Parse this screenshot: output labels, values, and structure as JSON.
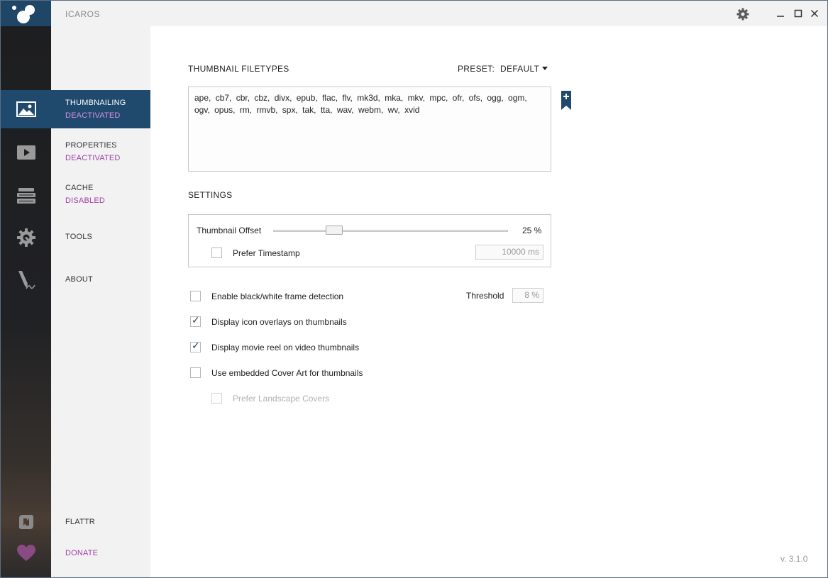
{
  "app": {
    "title": "ICAROS"
  },
  "nav": {
    "thumbnailing": {
      "label": "THUMBNAILING",
      "status": "DEACTIVATED"
    },
    "properties": {
      "label": "PROPERTIES",
      "status": "DEACTIVATED"
    },
    "cache": {
      "label": "CACHE",
      "status": "DISABLED"
    },
    "tools": {
      "label": "TOOLS"
    },
    "about": {
      "label": "ABOUT"
    },
    "flattr": {
      "label": "FLATTR"
    },
    "donate": {
      "label": "DONATE"
    }
  },
  "icons": {
    "rail": [
      "image-icon",
      "play-icon",
      "stack-icon",
      "gear-wrench-icon",
      "pen-icon",
      "flattr-icon",
      "heart-icon"
    ],
    "titlebar": [
      "gear-icon",
      "minimize-icon",
      "maximize-icon",
      "close-icon"
    ]
  },
  "colors": {
    "accent": "#1f4a6e",
    "status": "#a040a8",
    "heart": "#8a4a82"
  },
  "thumbnail_filetypes": {
    "title": "THUMBNAIL FILETYPES",
    "preset_label": "PRESET:",
    "preset_value": "DEFAULT",
    "list": "ape, cb7, cbr, cbz, divx, epub, flac, flv, mk3d, mka, mkv, mpc, ofr, ofs, ogg, ogm, ogv, opus, rm, rmvb, spx, tak, tta, wav, webm, wv, xvid"
  },
  "settings": {
    "title": "SETTINGS",
    "offset_label": "Thumbnail Offset",
    "offset_percent": 25,
    "offset_value": "25 %",
    "prefer_timestamp": {
      "label": "Prefer Timestamp",
      "checked": false
    },
    "timestamp_value": "10000 ms"
  },
  "options": {
    "bw_detection": {
      "label": "Enable black/white frame detection",
      "checked": false
    },
    "threshold_label": "Threshold",
    "threshold_value": "8 %",
    "icon_overlays": {
      "label": "Display icon overlays on thumbnails",
      "checked": true
    },
    "movie_reel": {
      "label": "Display movie reel on video thumbnails",
      "checked": true
    },
    "cover_art": {
      "label": "Use embedded Cover Art for thumbnails",
      "checked": false
    },
    "landscape_covers": {
      "label": "Prefer Landscape Covers",
      "checked": false,
      "disabled": true
    },
    "check_glyph": "✓"
  },
  "version": "v. 3.1.0"
}
